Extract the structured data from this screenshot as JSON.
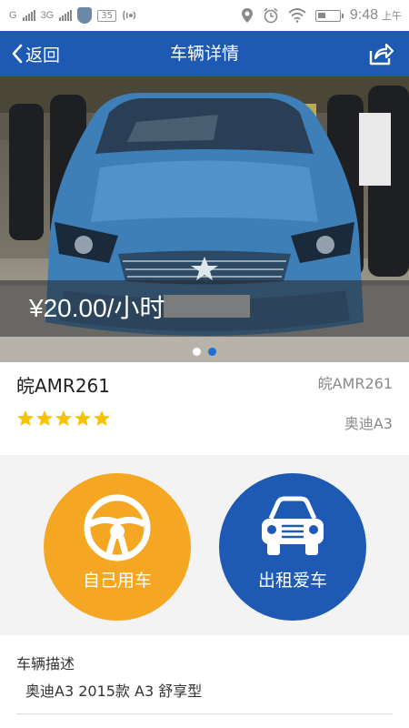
{
  "status_bar": {
    "carrier1": "G",
    "carrier2": "3G",
    "badge": "35",
    "time": "9:48",
    "ampm": "上午"
  },
  "nav": {
    "back_label": "返回",
    "title": "车辆详情",
    "share_icon": "share-icon"
  },
  "hero": {
    "price": "¥20.00/小时",
    "dots": [
      true,
      false
    ],
    "colors": {
      "dot_active": "#ffffff",
      "dot_inactive": "#1e6fd0"
    }
  },
  "car": {
    "plate": "皖AMR261",
    "plate_secondary": "皖AMR261",
    "model": "奥迪A3",
    "rating": 5,
    "star_color": "#f7c300"
  },
  "actions": {
    "self_use_label": "自己用车",
    "rent_out_label": "出租爱车",
    "self_use_color": "#f5a623",
    "rent_out_color": "#1e59b4"
  },
  "description": {
    "title": "车辆描述",
    "text": "奥迪A3 2015款 A3 舒享型"
  }
}
